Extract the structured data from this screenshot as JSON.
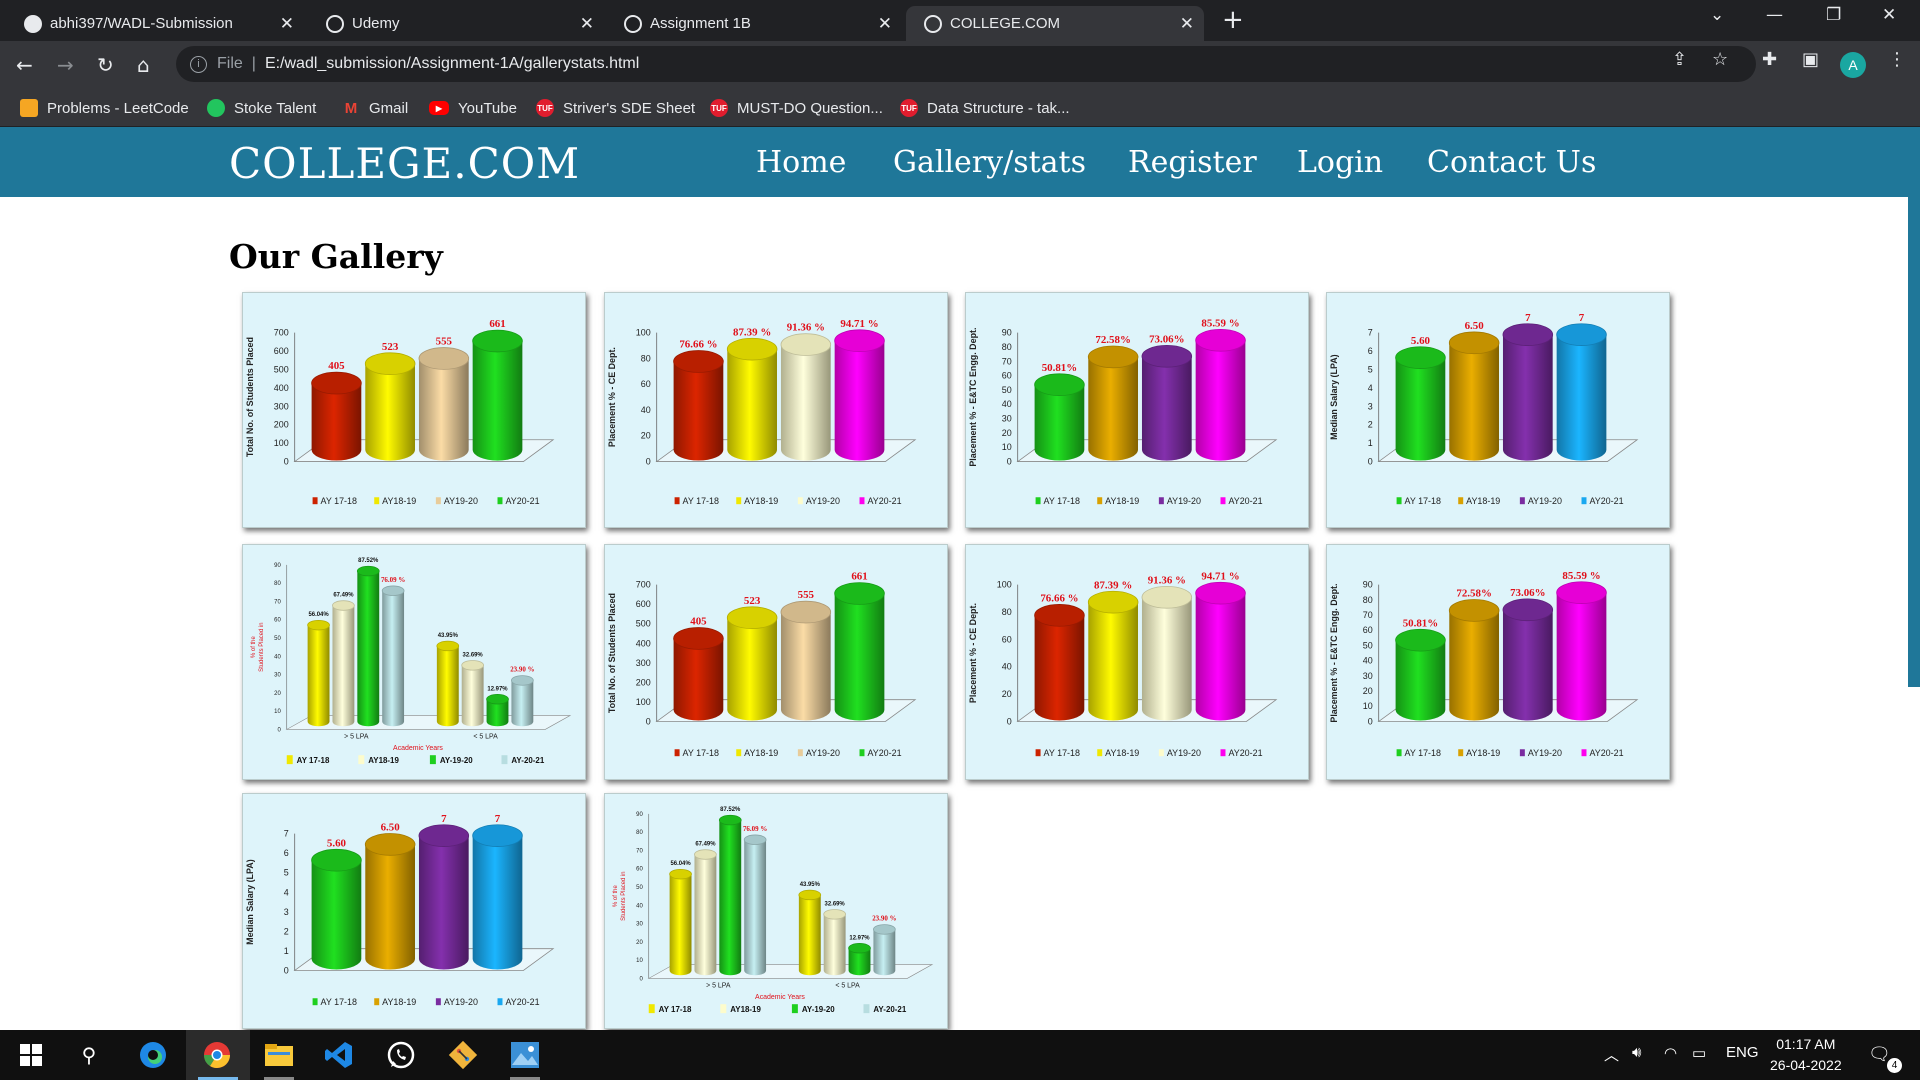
{
  "browser": {
    "tabs": [
      {
        "title": "abhi397/WADL-Submission",
        "active": false
      },
      {
        "title": "Udemy",
        "active": false
      },
      {
        "title": "Assignment 1B",
        "active": false
      },
      {
        "title": "COLLEGE.COM",
        "active": true
      }
    ],
    "address_prefix": "File",
    "url": "E:/wadl_submission/Assignment-1A/gallerystats.html",
    "profile_initial": "A",
    "bookmarks": [
      {
        "label": "Problems - LeetCode",
        "icon": "leetcode-icon",
        "color": "#f5a623"
      },
      {
        "label": "Stoke Talent",
        "icon": "stoke-icon",
        "color": "#22c55e"
      },
      {
        "label": "Gmail",
        "icon": "gmail-icon",
        "color": "#ea4335"
      },
      {
        "label": "YouTube",
        "icon": "youtube-icon",
        "color": "#ff0000"
      },
      {
        "label": "Striver's SDE Sheet",
        "icon": "tuf-icon",
        "color": "#e11d2e"
      },
      {
        "label": "MUST-DO Question...",
        "icon": "tuf-icon",
        "color": "#e11d2e"
      },
      {
        "label": "Data Structure - tak...",
        "icon": "tuf-icon",
        "color": "#e11d2e"
      }
    ]
  },
  "site": {
    "brand": "COLLEGE.COM",
    "nav": [
      "Home",
      "Gallery/stats",
      "Register",
      "Login",
      "Contact Us"
    ],
    "gallery_title": "Our Gallery",
    "accent": "#1f7799"
  },
  "legend": {
    "years": [
      "AY 17-18",
      "AY18-19",
      "AY19-20",
      "AY20-21"
    ],
    "niche_years": [
      "AY 17-18",
      "AY18-19",
      "AY-19-20",
      "AY-20-21"
    ]
  },
  "chart_data": [
    {
      "id": "students",
      "type": "bar",
      "ylabel": "Total No. of Students Placed",
      "categories": [
        "AY 17-18",
        "AY18-19",
        "AY19-20",
        "AY20-21"
      ],
      "values": [
        405,
        523,
        555,
        661
      ],
      "labels": [
        "405",
        "523",
        "555",
        "661"
      ],
      "yticks": [
        "0",
        "100",
        "200",
        "300",
        "400",
        "500",
        "600",
        "700"
      ],
      "ylim": [
        0,
        700
      ],
      "colors": [
        "#cc2200",
        "#f0e800",
        "#e8cc9a",
        "#1ecf1e"
      ]
    },
    {
      "id": "ce",
      "type": "bar",
      "ylabel": "Placement % - CE Dept.",
      "categories": [
        "AY 17-18",
        "AY18-19",
        "AY19-20",
        "AY20-21"
      ],
      "values": [
        76.66,
        87.39,
        91.36,
        94.71
      ],
      "labels": [
        "76.66 %",
        "87.39 %",
        "91.36 %",
        "94.71 %"
      ],
      "yticks": [
        "0",
        "20",
        "40",
        "60",
        "80",
        "100"
      ],
      "ylim": [
        0,
        100
      ],
      "colors": [
        "#cc2200",
        "#f0e800",
        "#fdfccc",
        "#ff00ee"
      ]
    },
    {
      "id": "entc",
      "type": "bar",
      "ylabel": "Placement % - E&TC Engg. Dept.",
      "categories": [
        "AY 17-18",
        "AY18-19",
        "AY19-20",
        "AY20-21"
      ],
      "values": [
        50.81,
        72.58,
        73.06,
        85.59
      ],
      "labels": [
        "50.81%",
        "72.58%",
        "73.06%",
        "85.59 %"
      ],
      "yticks": [
        "0",
        "10",
        "20",
        "30",
        "40",
        "50",
        "60",
        "70",
        "80",
        "90"
      ],
      "ylim": [
        0,
        90
      ],
      "colors": [
        "#1ecf1e",
        "#d9a100",
        "#7a2ca0",
        "#ff00ee"
      ]
    },
    {
      "id": "salary",
      "type": "bar",
      "ylabel": "Median Salary (LPA)",
      "categories": [
        "AY 17-18",
        "AY18-19",
        "AY19-20",
        "AY20-21"
      ],
      "values": [
        5.6,
        6.5,
        7,
        7
      ],
      "labels": [
        "5.60",
        "6.50",
        "7",
        "7"
      ],
      "yticks": [
        "0",
        "1",
        "2",
        "3",
        "4",
        "5",
        "6",
        "7"
      ],
      "ylim": [
        0,
        7
      ],
      "colors": [
        "#1ecf1e",
        "#d9a100",
        "#7a2ca0",
        "#19a8f0"
      ]
    },
    {
      "id": "niche",
      "type": "bar",
      "ylabel": "% of the Students Placed in the Niche Companies",
      "xlabel": "Academic Years",
      "groups": [
        "> 5 LPA",
        "< 5 LPA"
      ],
      "series": [
        {
          "name": "AY 17-18",
          "values": [
            56.04,
            43.95
          ],
          "labels": [
            "56.04%",
            "43.95%"
          ],
          "color": "#f0e800"
        },
        {
          "name": "AY18-19",
          "values": [
            67.49,
            32.69
          ],
          "labels": [
            "67.49%",
            "32.69%"
          ],
          "color": "#fdfccc"
        },
        {
          "name": "AY-19-20",
          "values": [
            87.52,
            12.97
          ],
          "labels": [
            "87.52%",
            "12.97%"
          ],
          "color": "#1ecf1e"
        },
        {
          "name": "AY-20-21",
          "values": [
            76.09,
            23.9
          ],
          "labels": [
            "76.09 %",
            "23.90 %"
          ],
          "color": "#b7dde0"
        }
      ],
      "yticks": [
        "0",
        "10",
        "20",
        "30",
        "40",
        "50",
        "60",
        "70",
        "80",
        "90"
      ],
      "ylim": [
        0,
        90
      ]
    }
  ],
  "gallery_order": [
    "students",
    "ce",
    "entc",
    "salary",
    "niche",
    "students",
    "ce",
    "entc",
    "salary",
    "niche"
  ],
  "taskbar": {
    "apps": [
      "windows-start-icon",
      "search-icon",
      "edge-icon",
      "chrome-icon",
      "file-explorer-icon",
      "vscode-icon",
      "whatsapp-icon",
      "git-icon",
      "photos-icon"
    ],
    "language": "ENG",
    "time": "01:17 AM",
    "date": "26-04-2022",
    "notifications": "4"
  }
}
